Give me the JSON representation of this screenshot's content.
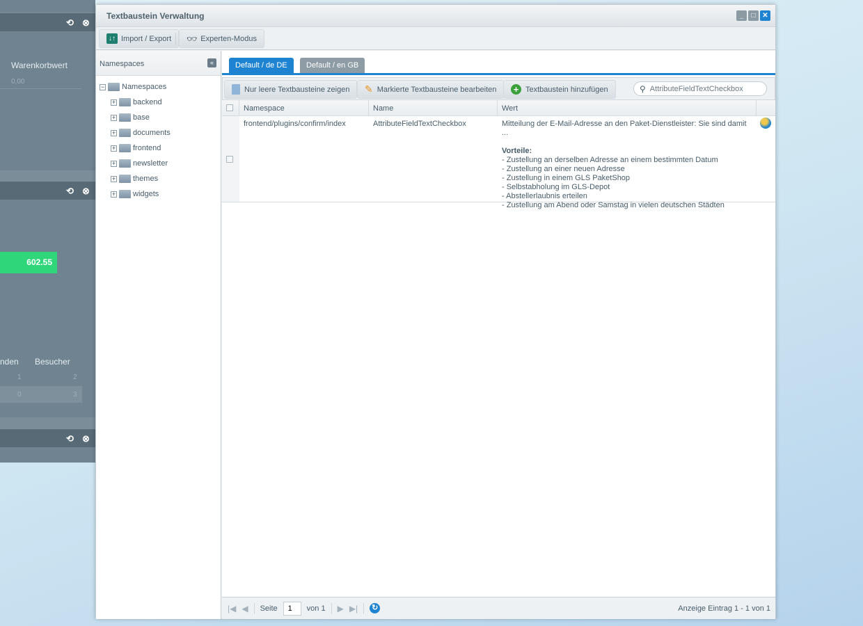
{
  "background": {
    "panel1": {
      "column": "Warenkorbwert",
      "value": "0,00"
    },
    "panel2": {
      "bar_value": "602.55",
      "bar_color": "#2fd67a",
      "columns": [
        "nden",
        "Besucher"
      ],
      "rows": [
        [
          "1",
          "2"
        ],
        [
          "0",
          "3"
        ]
      ]
    },
    "icons": [
      "refresh-icon",
      "close-icon"
    ]
  },
  "window": {
    "title": "Textbaustein Verwaltung",
    "toolbar": {
      "import_export": "Import / Export",
      "expert_mode": "Experten-Modus"
    },
    "tree": {
      "header": "Namespaces",
      "root": "Namespaces",
      "children": [
        "backend",
        "base",
        "documents",
        "frontend",
        "newsletter",
        "themes",
        "widgets"
      ]
    },
    "tabs": [
      {
        "label": "Default / de  DE",
        "active": true
      },
      {
        "label": "Default / en  GB",
        "active": false
      }
    ],
    "grid_toolbar": {
      "empty_only": "Nur leere Textbausteine zeigen",
      "edit_marked": "Markierte Textbausteine bearbeiten",
      "add": "Textbaustein hinzufügen",
      "search_value": "AttributeFieldTextCheckbox"
    },
    "columns": [
      "Namespace",
      "Name",
      "Wert"
    ],
    "rows": [
      {
        "namespace": "frontend/plugins/confirm/index",
        "name": "AttributeFieldTextCheckbox",
        "value_first": "Mitteilung der E-Mail-Adresse an den Paket-Dienstleister: Sie sind damit ...",
        "value_heading": "Vorteile:",
        "value_lines": [
          "- Zustellung an derselben Adresse an einem bestimmten Datum",
          "- Zustellung an einer neuen Adresse",
          "- Zustellung in einem GLS PaketShop",
          "- Selbstabholung im GLS-Depot",
          "- Abstellerlaubnis erteilen",
          "- Zustellung am Abend oder Samstag in vielen deutschen Städten"
        ]
      }
    ],
    "paging": {
      "page_label": "Seite",
      "page": "1",
      "of": "von 1",
      "summary": "Anzeige Eintrag 1 - 1 von 1"
    },
    "accent": "#1e84d1"
  }
}
